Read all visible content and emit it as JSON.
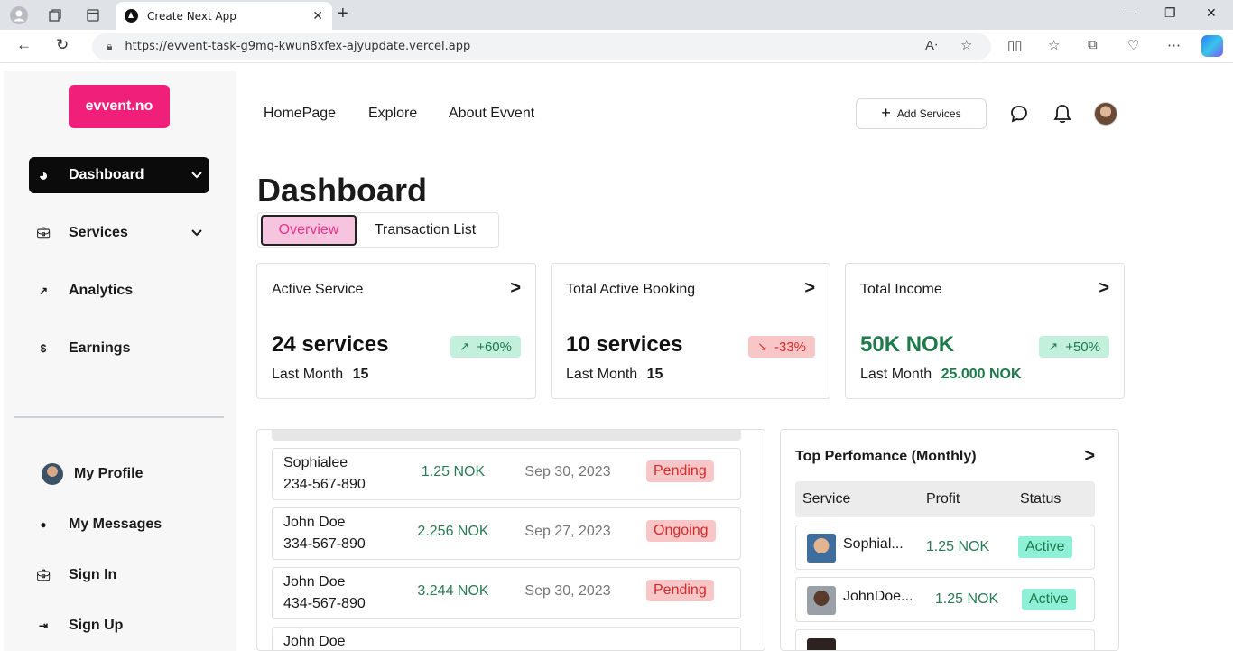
{
  "browser": {
    "tab_title": "Create Next App",
    "url": "https://evvent-task-g9mq-kwun8xfex-ajyupdate.vercel.app"
  },
  "sidebar": {
    "logo": "evvent.no",
    "items": [
      {
        "label": "Dashboard",
        "icon": "pie-chart-icon"
      },
      {
        "label": "Services",
        "icon": "briefcase-icon"
      },
      {
        "label": "Analytics",
        "icon": "trend-up-icon"
      },
      {
        "label": "Earnings",
        "icon": "dollar-icon"
      }
    ],
    "bottom_items": [
      {
        "label": "My Profile",
        "icon": "avatar"
      },
      {
        "label": "My Messages",
        "icon": "chat-icon"
      },
      {
        "label": "Sign In",
        "icon": "briefcase-icon"
      },
      {
        "label": "Sign Up",
        "icon": "sign-in-icon"
      }
    ]
  },
  "header": {
    "nav": [
      "HomePage",
      "Explore",
      "About Evvent"
    ],
    "add_services": "Add Services"
  },
  "main": {
    "title": "Dashboard",
    "tabs": [
      "Overview",
      "Transaction List"
    ],
    "cards": [
      {
        "title": "Active Service",
        "value": "24 services",
        "change": "+60%",
        "trend": "up",
        "last_label": "Last Month",
        "last_value": "15"
      },
      {
        "title": "Total Active Booking",
        "value": "10 services",
        "change": "-33%",
        "trend": "down",
        "last_label": "Last Month",
        "last_value": "15"
      },
      {
        "title": "Total Income",
        "value": "50K NOK",
        "change": "+50%",
        "trend": "up",
        "last_label": "Last Month",
        "last_value": "25.000 NOK"
      }
    ],
    "transactions": [
      {
        "name": "Sophialee",
        "phone": "234-567-890",
        "amount": "1.25 NOK",
        "date": "Sep 30, 2023",
        "status": "Pending"
      },
      {
        "name": "John Doe",
        "phone": "334-567-890",
        "amount": "2.256 NOK",
        "date": "Sep 27, 2023",
        "status": "Ongoing"
      },
      {
        "name": "John Doe",
        "phone": "434-567-890",
        "amount": "3.244 NOK",
        "date": "Sep 30, 2023",
        "status": "Pending"
      },
      {
        "name": "John Doe",
        "phone": "",
        "amount": "",
        "date": "",
        "status": ""
      }
    ],
    "top_performance": {
      "title": "Top Perfomance (Monthly)",
      "columns": [
        "Service",
        "Profit",
        "Status"
      ],
      "rows": [
        {
          "name": "Sophial...",
          "profit": "1.25 NOK",
          "status": "Active"
        },
        {
          "name": "JohnDoe...",
          "profit": "1.25 NOK",
          "status": "Active"
        }
      ]
    }
  },
  "colors": {
    "brand": "#ef1f7a",
    "positive": "#1e7a4a",
    "negative": "#d42a2a"
  }
}
